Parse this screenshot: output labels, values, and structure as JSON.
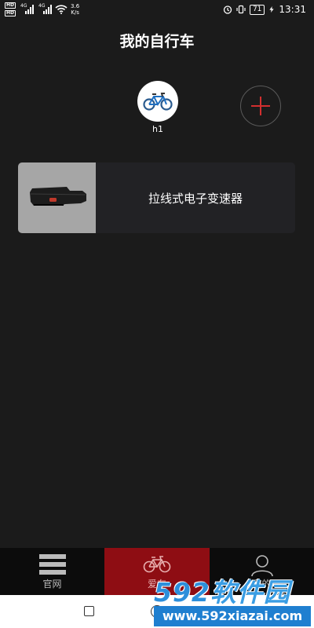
{
  "status_bar": {
    "hd1": "HD",
    "hd2": "HD",
    "sim1_index": "1",
    "sim2_index": "2",
    "net1": "4G",
    "net2": "4G",
    "speed_value": "3.6",
    "speed_unit": "K/s",
    "battery": "71",
    "time": "13:31"
  },
  "page": {
    "title": "我的自行车"
  },
  "bikes": [
    {
      "name": "h1"
    }
  ],
  "device": {
    "label": "拉线式电子变速器"
  },
  "bottom_nav": [
    {
      "label": "官网",
      "icon": "menu-icon",
      "active": false
    },
    {
      "label": "爱车",
      "icon": "bicycle-icon",
      "active": true
    },
    {
      "label": "我的",
      "icon": "person-icon",
      "active": false
    }
  ],
  "watermark": {
    "brand": "592",
    "suffix": "软件园",
    "url": "www.592xiazai.com"
  },
  "colors": {
    "background": "#1b1b1b",
    "accent": "#8e0d13",
    "add_plus": "#d32f2f",
    "watermark_blue": "#1f7fd0"
  }
}
